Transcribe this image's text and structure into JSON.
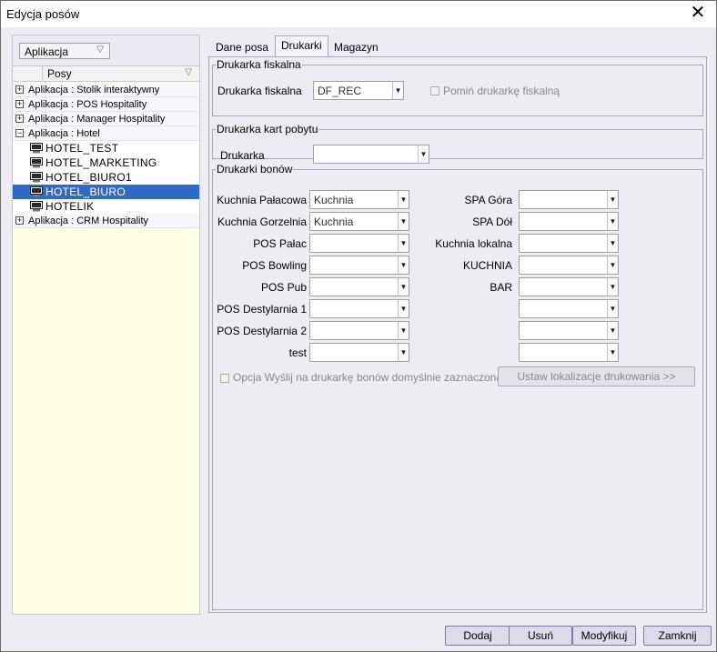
{
  "window": {
    "title": "Edycja posów",
    "close_glyph": "✕"
  },
  "left": {
    "group_chip": "Aplikacja",
    "column_header": "Posy",
    "tree": [
      {
        "type": "group",
        "expander": "+",
        "label": "Aplikacja : Stolik interaktywny"
      },
      {
        "type": "group",
        "expander": "+",
        "label": "Aplikacja : POS Hospitality"
      },
      {
        "type": "group",
        "expander": "+",
        "label": "Aplikacja : Manager Hospitality"
      },
      {
        "type": "group",
        "expander": "−",
        "label": "Aplikacja : Hotel"
      },
      {
        "type": "child",
        "label": "HOTEL_TEST"
      },
      {
        "type": "child",
        "label": "HOTEL_MARKETING"
      },
      {
        "type": "child",
        "label": "HOTEL_BIURO1"
      },
      {
        "type": "child",
        "label": "HOTEL_BIURO",
        "selected": true
      },
      {
        "type": "child",
        "label": "HOTELIK"
      },
      {
        "type": "group",
        "expander": "+",
        "label": "Aplikacja : CRM Hospitality"
      }
    ]
  },
  "tabs": [
    "Dane posa",
    "Drukarki",
    "Magazyn"
  ],
  "active_tab": "Drukarki",
  "fiscal": {
    "legend": "Drukarka fiskalna",
    "label": "Drukarka fiskalna",
    "value": "DF_REC",
    "skip_label": "Pomiń drukarkę fiskalną"
  },
  "card": {
    "legend": "Drukarka kart pobytu",
    "label": "Drukarka",
    "value": ""
  },
  "bons": {
    "legend": "Drukarki bonów",
    "left": [
      {
        "label": "Kuchnia Pałacowa",
        "value": "Kuchnia"
      },
      {
        "label": "Kuchnia Gorzelnia",
        "value": "Kuchnia"
      },
      {
        "label": "POS Pałac",
        "value": ""
      },
      {
        "label": "POS Bowling",
        "value": ""
      },
      {
        "label": "POS Pub",
        "value": ""
      },
      {
        "label": "POS Destylarnia 1",
        "value": ""
      },
      {
        "label": "POS Destylarnia 2",
        "value": ""
      },
      {
        "label": "test",
        "value": ""
      }
    ],
    "right": [
      {
        "label": "SPA Góra",
        "value": ""
      },
      {
        "label": "SPA Dół",
        "value": ""
      },
      {
        "label": "Kuchnia lokalna",
        "value": ""
      },
      {
        "label": "KUCHNIA",
        "value": ""
      },
      {
        "label": "BAR",
        "value": ""
      },
      {
        "label": "",
        "value": ""
      },
      {
        "label": "",
        "value": ""
      },
      {
        "label": "",
        "value": ""
      }
    ],
    "option_label": "Opcja Wyślij na drukarkę bonów domyślnie zaznaczona",
    "set_location_button": "Ustaw lokalizacje drukowania >>"
  },
  "buttons": {
    "add": "Dodaj",
    "delete": "Usuń",
    "modify": "Modyfikuj",
    "close": "Zamknij"
  }
}
